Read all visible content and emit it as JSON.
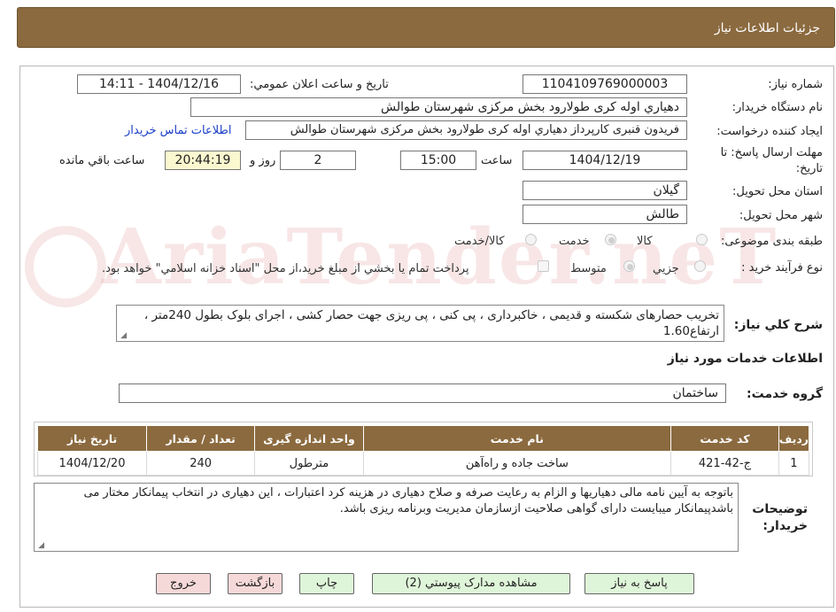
{
  "header": {
    "title": "جزئیات اطلاعات نیاز"
  },
  "watermark": "AriaTender.neT",
  "fields": {
    "need_number_label": "شماره نیاز:",
    "need_number": "1104109769000003",
    "announce_label": "تاریخ و ساعت اعلان عمومي:",
    "announce_value": "1404/12/16 - 14:11",
    "buyer_org_label": "نام دستگاه خريدار:",
    "buyer_org": "دهياري اوله کری طولارود بخش مرکزی شهرستان طوالش",
    "requester_label": "ايجاد کننده درخواست:",
    "requester": "فريدون قنبری کارپرداز دهياري اوله کری طولارود بخش مرکزی شهرستان طوالش",
    "contact_link": "اطلاعات تماس خريدار",
    "deadline_label_1": "مهلت ارسال پاسخ: تا",
    "deadline_label_2": "تاريخ:",
    "deadline_date": "1404/12/19",
    "time_label": "ساعت",
    "deadline_time": "15:00",
    "days_value": "2",
    "days_label": "روز و",
    "remaining_time": "20:44:19",
    "remaining_label": "ساعت باقي مانده",
    "province_label": "استان محل تحویل:",
    "province": "گيلان",
    "city_label": "شهر محل تحویل:",
    "city": "طالش",
    "category_label": "طبقه بندی موضوعی:",
    "category_options": [
      "کالا",
      "خدمت",
      "کالا/خدمت"
    ],
    "process_label": "نوع فرآیند خرید :",
    "process_options": [
      "جزيي",
      "متوسط"
    ],
    "payment_note": "پرداخت تمام يا بخشي از مبلغ خريد،از محل \"اسناد خزانه اسلامي\" خواهد بود."
  },
  "description": {
    "label": "شرح كلي نياز:",
    "text": "تخريب حصارهاى شكسته و قديمى ، خاكبردارى ، پى كنى ، پى ريزى جهت حصار كشى ، اجراى بلوک بطول 240متر ، ارتفاع1.60"
  },
  "services": {
    "section_title": "اطلاعات خدمات مورد نياز",
    "group_label": "گروه خدمت:",
    "group_value": "ساختمان"
  },
  "table": {
    "headers": [
      "رديف",
      "كد خدمت",
      "نام خدمت",
      "واحد اندازه گيری",
      "تعداد / مقدار",
      "تاريخ نياز"
    ],
    "rows": [
      [
        "1",
        "ج-42-421",
        "ساخت جاده و راه‌آهن",
        "مترطول",
        "240",
        "1404/12/20"
      ]
    ]
  },
  "notes": {
    "label_1": "توضيحات",
    "label_2": "خريدار:",
    "text": "باتوجه به آيين نامه مالى دهياريها و الزام به رعايت صرفه و صلاح دهيارى در هزينه كرد اعتبارات ، اين دهيارى در انتخاب پيمانكار مختار مى باشدپيمانكار ميبايست داراى گواهى صلاحيت ازسازمان مديريت وبرنامه ريزى باشد."
  },
  "buttons": {
    "reply": "پاسخ به نياز",
    "attachments": "مشاهده مدارک پيوستي (2)",
    "print": "چاپ",
    "back": "بازگشت",
    "exit": "خروج"
  },
  "colors": {
    "header_bg": "#8b6a3f",
    "link": "#1a3ec8",
    "remaining_bg": "#fbf7cf",
    "button_green": "#dff5d9",
    "button_pink": "#f5d8d8"
  }
}
